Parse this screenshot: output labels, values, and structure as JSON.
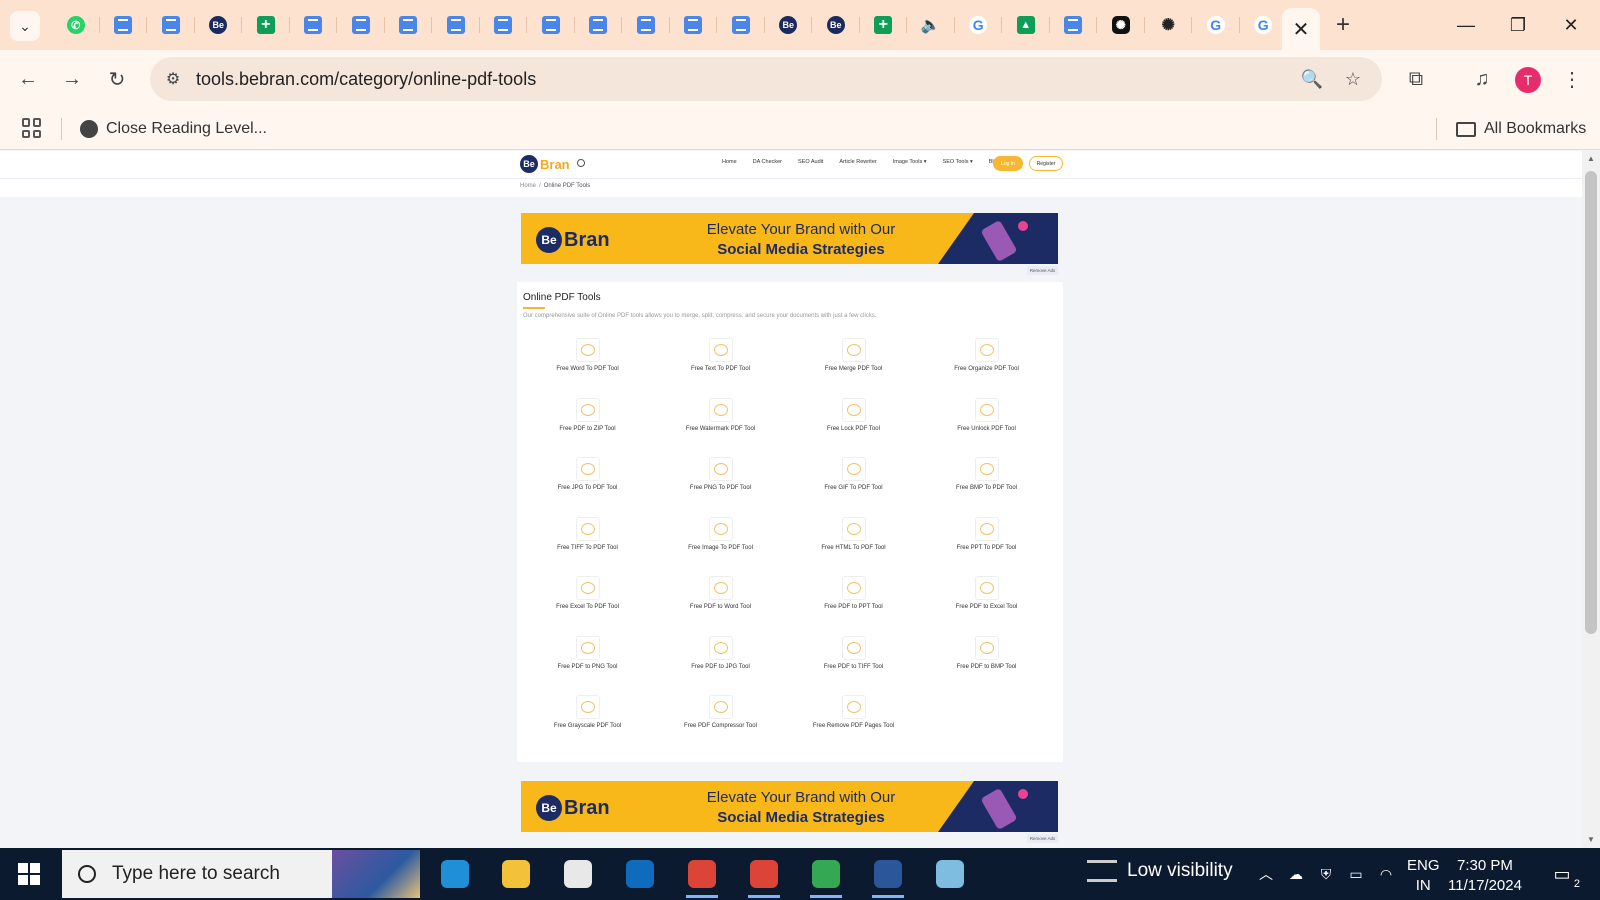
{
  "browser": {
    "tabs": [
      {
        "icon": "whatsapp-icon",
        "kind": "wa",
        "glyph": "✆"
      },
      {
        "icon": "docs-icon",
        "kind": "doc",
        "glyph": ""
      },
      {
        "icon": "docs-icon",
        "kind": "doc",
        "glyph": ""
      },
      {
        "icon": "bebran-icon",
        "kind": "be",
        "glyph": "Be"
      },
      {
        "icon": "sheets-icon",
        "kind": "sheet",
        "glyph": "+"
      },
      {
        "icon": "docs-icon",
        "kind": "doc",
        "glyph": ""
      },
      {
        "icon": "docs-icon",
        "kind": "doc",
        "glyph": ""
      },
      {
        "icon": "docs-icon",
        "kind": "doc",
        "glyph": ""
      },
      {
        "icon": "docs-icon",
        "kind": "doc",
        "glyph": ""
      },
      {
        "icon": "docs-icon",
        "kind": "doc",
        "glyph": ""
      },
      {
        "icon": "docs-icon",
        "kind": "doc",
        "glyph": ""
      },
      {
        "icon": "docs-icon",
        "kind": "doc",
        "glyph": ""
      },
      {
        "icon": "docs-icon",
        "kind": "doc",
        "glyph": ""
      },
      {
        "icon": "docs-icon",
        "kind": "doc",
        "glyph": ""
      },
      {
        "icon": "docs-icon",
        "kind": "doc",
        "glyph": ""
      },
      {
        "icon": "bebran-icon",
        "kind": "be",
        "glyph": "Be"
      },
      {
        "icon": "bebran-icon",
        "kind": "be",
        "glyph": "Be"
      },
      {
        "icon": "sheets-icon",
        "kind": "sheet",
        "glyph": "+"
      },
      {
        "icon": "speaker-icon",
        "kind": "snd",
        "glyph": "🔈"
      },
      {
        "icon": "google-icon",
        "kind": "g",
        "glyph": "G"
      },
      {
        "icon": "android-icon",
        "kind": "andr",
        "glyph": "▲"
      },
      {
        "icon": "docs-icon",
        "kind": "doc",
        "glyph": ""
      },
      {
        "icon": "chatgpt-icon",
        "kind": "gpt",
        "glyph": "✺"
      },
      {
        "icon": "chatgpt-icon",
        "kind": "gpt2",
        "glyph": "✺"
      },
      {
        "icon": "google-icon",
        "kind": "g",
        "glyph": "G"
      },
      {
        "icon": "google-icon",
        "kind": "g",
        "glyph": "G"
      }
    ],
    "url": "tools.bebran.com/category/online-pdf-tools",
    "profile_initial": "T",
    "bookmark_item": "Close Reading Level...",
    "all_bookmarks": "All Bookmarks",
    "colors": {
      "frame": "#fde3cf",
      "toolbar": "#fff6ef",
      "avatar": "#e52d6b"
    }
  },
  "site": {
    "logo_be": "Be",
    "logo_bran": "Bran",
    "nav": [
      "Home",
      "DA Checker",
      "SEO Audit",
      "Article Rewriter",
      "Image Tools ▾",
      "SEO Tools ▾",
      "Blog"
    ],
    "login": "Log In",
    "register": "Register",
    "breadcrumb_home": "Home",
    "breadcrumb_sep": "/",
    "breadcrumb_current": "Online PDF Tools",
    "banner": {
      "logo_be": "Be",
      "logo_bran": "Bran",
      "line1": "Elevate Your Brand with Our",
      "line2": "Social Media Strategies"
    },
    "remove_ads": "Remove Ads",
    "section_title": "Online PDF Tools",
    "section_desc": "Our comprehensive suite of Online PDF tools allows you to merge, split, compress, and secure your documents with just a few clicks.",
    "tools": [
      "Free Word To PDF Tool",
      "Free Text To PDF Tool",
      "Free Merge PDF Tool",
      "Free Organize PDF Tool",
      "Free PDF to ZIP Tool",
      "Free Watermark PDF Tool",
      "Free Lock PDF Tool",
      "Free Unlock PDF Tool",
      "Free JPG To PDF Tool",
      "Free PNG To PDF Tool",
      "Free GIF To PDF Tool",
      "Free BMP To PDF Tool",
      "Free TIFF To PDF Tool",
      "Free Image To PDF Tool",
      "Free HTML To PDF Tool",
      "Free PPT To PDF Tool",
      "Free Excel To PDF Tool",
      "Free PDF to Word Tool",
      "Free PDF to PPT Tool",
      "Free PDF to Excel Tool",
      "Free PDF to PNG Tool",
      "Free PDF to JPG Tool",
      "Free PDF to TIFF Tool",
      "Free PDF to BMP Tool",
      "Free Grayscale PDF Tool",
      "Free PDF Compressor Tool",
      "Free Remove PDF Pages Tool"
    ],
    "colors": {
      "accent": "#f7b731",
      "brand": "#1d2b64",
      "banner": "#f9b81a"
    }
  },
  "taskbar": {
    "search_placeholder": "Type here to search",
    "apps": [
      {
        "name": "edge-icon",
        "color": "#1f8fd8",
        "active": false
      },
      {
        "name": "file-explorer-icon",
        "color": "#f3c13a",
        "active": false
      },
      {
        "name": "store-icon",
        "color": "#e8e8e8",
        "active": false
      },
      {
        "name": "outlook-icon",
        "color": "#0f6cbd",
        "active": false
      },
      {
        "name": "chrome-icon",
        "color": "#db4437",
        "active": true
      },
      {
        "name": "chrome-icon",
        "color": "#db4437",
        "active": true
      },
      {
        "name": "chrome-icon",
        "color": "#34a853",
        "active": true
      },
      {
        "name": "word-icon",
        "color": "#2b579a",
        "active": true
      },
      {
        "name": "notepad-icon",
        "color": "#7fbde0",
        "active": false
      }
    ],
    "weather": "Low visibility",
    "lang_line1": "ENG",
    "lang_line2": "IN",
    "time": "7:30 PM",
    "date": "11/17/2024",
    "notification_count": "2"
  }
}
